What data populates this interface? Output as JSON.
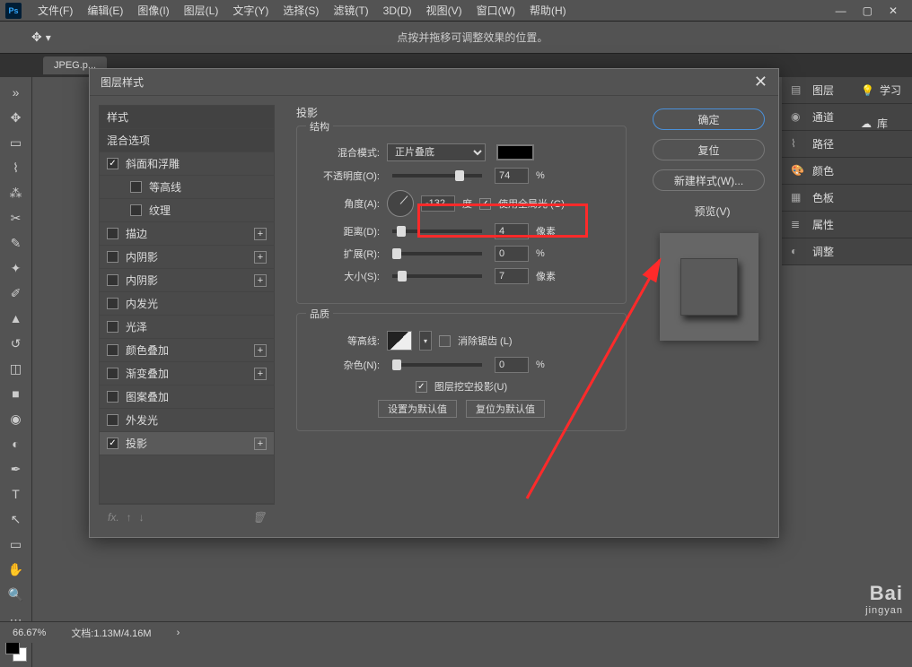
{
  "menu": {
    "items": [
      "文件(F)",
      "编辑(E)",
      "图像(I)",
      "图层(L)",
      "文字(Y)",
      "选择(S)",
      "滤镜(T)",
      "3D(D)",
      "视图(V)",
      "窗口(W)",
      "帮助(H)"
    ]
  },
  "options_hint": "点按并拖移可调整效果的位置。",
  "doc_tab": "JPEG.p...",
  "right_panels": [
    "图层",
    "通道",
    "路径",
    "颜色",
    "色板",
    "属性",
    "调整"
  ],
  "right_extra": [
    "学习",
    "库"
  ],
  "status": {
    "zoom": "66.67%",
    "doc": "文档:1.13M/4.16M"
  },
  "dialog": {
    "title": "图层样式",
    "styles_header": "样式",
    "blend_options": "混合选项",
    "list": [
      {
        "label": "斜面和浮雕",
        "checked": true,
        "plus": false,
        "indent": 0
      },
      {
        "label": "等高线",
        "checked": false,
        "plus": false,
        "indent": 1
      },
      {
        "label": "纹理",
        "checked": false,
        "plus": false,
        "indent": 1
      },
      {
        "label": "描边",
        "checked": false,
        "plus": true,
        "indent": 0
      },
      {
        "label": "内阴影",
        "checked": false,
        "plus": true,
        "indent": 0
      },
      {
        "label": "内阴影",
        "checked": false,
        "plus": true,
        "indent": 0
      },
      {
        "label": "内发光",
        "checked": false,
        "plus": false,
        "indent": 0
      },
      {
        "label": "光泽",
        "checked": false,
        "plus": false,
        "indent": 0
      },
      {
        "label": "颜色叠加",
        "checked": false,
        "plus": true,
        "indent": 0
      },
      {
        "label": "渐变叠加",
        "checked": false,
        "plus": true,
        "indent": 0
      },
      {
        "label": "图案叠加",
        "checked": false,
        "plus": false,
        "indent": 0
      },
      {
        "label": "外发光",
        "checked": false,
        "plus": false,
        "indent": 0
      },
      {
        "label": "投影",
        "checked": true,
        "plus": true,
        "indent": 0,
        "selected": true
      }
    ],
    "section_title": "投影",
    "structure_legend": "结构",
    "quality_legend": "品质",
    "blend_mode_label": "混合模式:",
    "blend_mode_value": "正片叠底",
    "opacity_label": "不透明度(O):",
    "opacity_value": "74",
    "angle_label": "角度(A):",
    "angle_value": "-132",
    "angle_unit": "度",
    "global_light": "使用全局光 (G)",
    "distance_label": "距离(D):",
    "distance_value": "4",
    "px": "像素",
    "spread_label": "扩展(R):",
    "spread_value": "0",
    "pct": "%",
    "size_label": "大小(S):",
    "size_value": "7",
    "contour_label": "等高线:",
    "antialias": "消除锯齿 (L)",
    "noise_label": "杂色(N):",
    "noise_value": "0",
    "knockout": "图层挖空投影(U)",
    "set_default": "设置为默认值",
    "reset_default": "复位为默认值",
    "btn_ok": "确定",
    "btn_cancel": "复位",
    "btn_new": "新建样式(W)...",
    "preview": "预览(V)"
  },
  "watermark": {
    "main": "Bai",
    "sub": "jingyan"
  }
}
